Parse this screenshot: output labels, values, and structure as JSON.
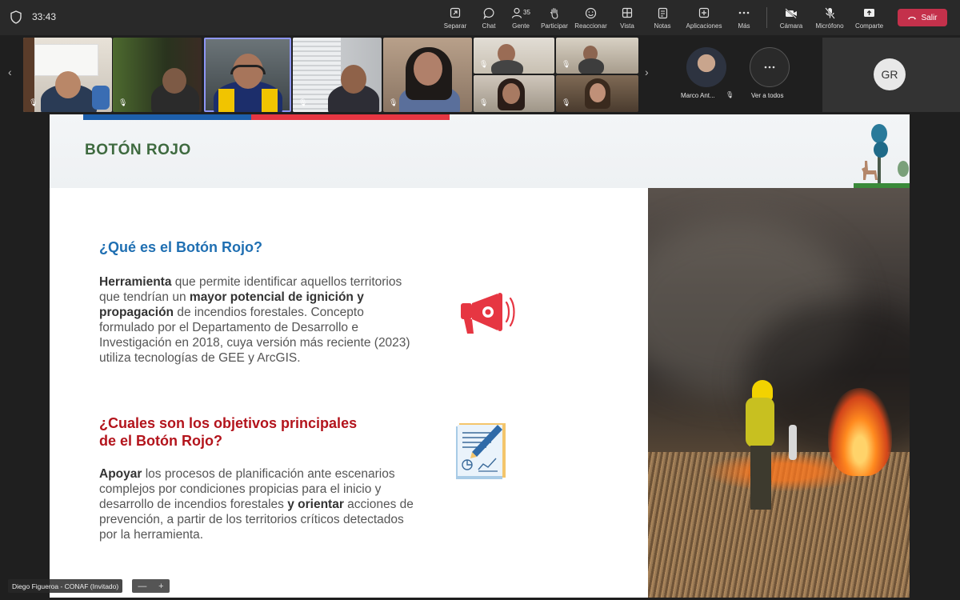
{
  "meeting": {
    "timer": "33:43"
  },
  "toolbar": {
    "items": [
      {
        "label": "Separar",
        "icon": "pop-out-icon"
      },
      {
        "label": "Chat",
        "icon": "chat-icon"
      },
      {
        "label": "Gente",
        "icon": "people-icon",
        "count": "35"
      },
      {
        "label": "Participar",
        "icon": "raise-hand-icon"
      },
      {
        "label": "Reaccionar",
        "icon": "emoji-icon"
      },
      {
        "label": "Vista",
        "icon": "grid-icon"
      },
      {
        "label": "Notas",
        "icon": "notes-icon"
      },
      {
        "label": "Aplicaciones",
        "icon": "add-icon"
      },
      {
        "label": "Más",
        "icon": "more-icon"
      }
    ],
    "media": [
      {
        "label": "Cámara",
        "icon": "camera-off-icon"
      },
      {
        "label": "Micrófono",
        "icon": "mic-off-icon"
      },
      {
        "label": "Comparte",
        "icon": "share-icon"
      }
    ],
    "exit_label": "Salir",
    "exit_color": "#c4314b"
  },
  "participants": {
    "featured_name": "Marco Ant...",
    "see_all_label": "Ver a todos",
    "initials": "GR"
  },
  "slide": {
    "title": "BOTÓN ROJO",
    "q1": "¿Qué es el Botón Rojo?",
    "p1_b1": "Herramienta",
    "p1_t1": " que permite identificar aquellos territorios que tendrían un ",
    "p1_b2": "mayor potencial de ignición y propagación",
    "p1_t2": " de incendios forestales. Concepto formulado por el Departamento de Desarrollo e Investigación en 2018, cuya versión más reciente (2023) utiliza tecnologías de GEE y ArcGIS.",
    "q2": "¿Cuales son  los objetivos principales de el Botón Rojo?",
    "p2_b1": "Apoyar",
    "p2_t1": " los procesos de planificación ante escenarios complejos por condiciones propicias para el inicio y desarrollo de incendios forestales ",
    "p2_b2": "y orientar",
    "p2_t2": " acciones de prevención, a partir de los territorios críticos detectados por la herramienta.",
    "colors": {
      "title": "#3e6a3f",
      "q1": "#1f6fb2",
      "q2": "#b3141c",
      "bar_blue": "#1d5fab",
      "bar_red": "#e63642"
    }
  },
  "presenter": {
    "name": "Diego Figueroa - CONAF (Invitado)"
  },
  "zoom_controls": {
    "minus": "—",
    "plus": "+"
  }
}
